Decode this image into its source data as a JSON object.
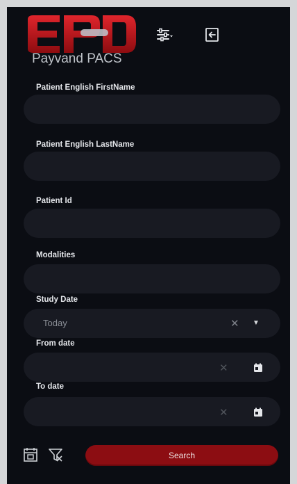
{
  "header": {
    "brand": "Payvand PACS",
    "logo_icon": "epd-logo",
    "filter_icon": "sliders-icon",
    "logout_icon": "exit-icon",
    "accent_color": "#c3161c"
  },
  "form": {
    "first_name": {
      "label": "Patient English FirstName",
      "value": ""
    },
    "last_name": {
      "label": "Patient English LastName",
      "value": ""
    },
    "patient_id": {
      "label": "Patient Id",
      "value": ""
    },
    "modalities": {
      "label": "Modalities",
      "value": ""
    },
    "study_date": {
      "label": "Study Date",
      "value": "Today"
    },
    "from_date": {
      "label": "From date",
      "value": ""
    },
    "to_date": {
      "label": "To date",
      "value": ""
    }
  },
  "footer": {
    "left_icon": "calendar-reset-icon",
    "right_icon": "clear-filter-icon",
    "search_label": "Search"
  }
}
